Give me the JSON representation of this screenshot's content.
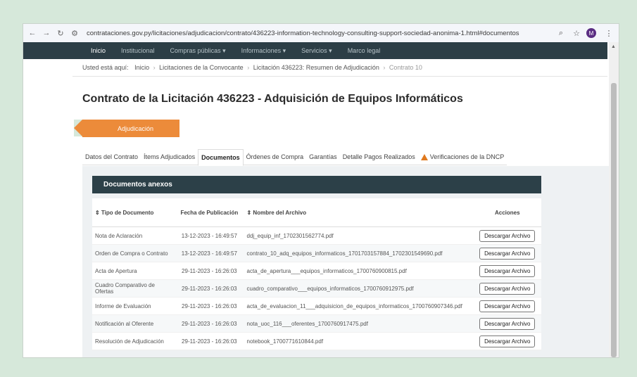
{
  "browser": {
    "url": "contrataciones.gov.py/licitaciones/adjudicacion/contrato/436223-information-technology-consulting-support-sociedad-anonima-1.html#documentos",
    "profile_initial": "M"
  },
  "topnav": [
    "Inicio",
    "Institucional",
    "Compras públicas ▾",
    "Informaciones ▾",
    "Servicios ▾",
    "Marco legal"
  ],
  "breadcrumb": {
    "prefix": "Usted está aquí:",
    "items": [
      "Inicio",
      "Licitaciones de la Convocante",
      "Licitación 436223: Resumen de Adjudicación"
    ],
    "current": "Contrato 10"
  },
  "title": "Contrato de la Licitación 436223 - Adquisición de Equipos Informáticos",
  "ribbon": "Adjudicación",
  "tabs": [
    "Datos del Contrato",
    "Ítems Adjudicados",
    "Documentos",
    "Órdenes de Compra",
    "Garantías",
    "Detalle Pagos Realizados",
    "Verificaciones de la DNCP"
  ],
  "active_tab": "Documentos",
  "docs": {
    "heading": "Documentos anexos",
    "columns": [
      "⇕ Tipo de Documento",
      "Fecha de Publicación",
      "⇕ Nombre del Archivo",
      "Acciones"
    ],
    "rows": [
      {
        "tipo": "Nota de Aclaración",
        "fecha": "13-12-2023 - 16:49:57",
        "nombre": "ddj_equip_inf_1702301562774.pdf",
        "accion": "Descargar Archivo"
      },
      {
        "tipo": "Orden de Compra o Contrato",
        "fecha": "13-12-2023 - 16:49:57",
        "nombre": "contrato_10_adq_equipos_informaticos_1701703157884_1702301549690.pdf",
        "accion": "Descargar Archivo"
      },
      {
        "tipo": "Acta de Apertura",
        "fecha": "29-11-2023 - 16:26:03",
        "nombre": "acta_de_apertura___equipos_informaticos_1700760900815.pdf",
        "accion": "Descargar Archivo"
      },
      {
        "tipo": "Cuadro Comparativo de Ofertas",
        "fecha": "29-11-2023 - 16:26:03",
        "nombre": "cuadro_comparativo___equipos_informaticos_1700760912975.pdf",
        "accion": "Descargar Archivo"
      },
      {
        "tipo": "Informe de Evaluación",
        "fecha": "29-11-2023 - 16:26:03",
        "nombre": "acta_de_evaluacion_11___adquisicion_de_equipos_informaticos_1700760907346.pdf",
        "accion": "Descargar Archivo"
      },
      {
        "tipo": "Notificación al Oferente",
        "fecha": "29-11-2023 - 16:26:03",
        "nombre": "nota_uoc_116___oferentes_1700760917475.pdf",
        "accion": "Descargar Archivo"
      },
      {
        "tipo": "Resolución de Adjudicación",
        "fecha": "29-11-2023 - 16:26:03",
        "nombre": "notebook_1700771610844.pdf",
        "accion": "Descargar Archivo"
      }
    ]
  },
  "colors": {
    "nav": "#2c3e46",
    "header": "#2c4048",
    "accent": "#ec8b3a",
    "page_bg": "#d6e8da"
  }
}
